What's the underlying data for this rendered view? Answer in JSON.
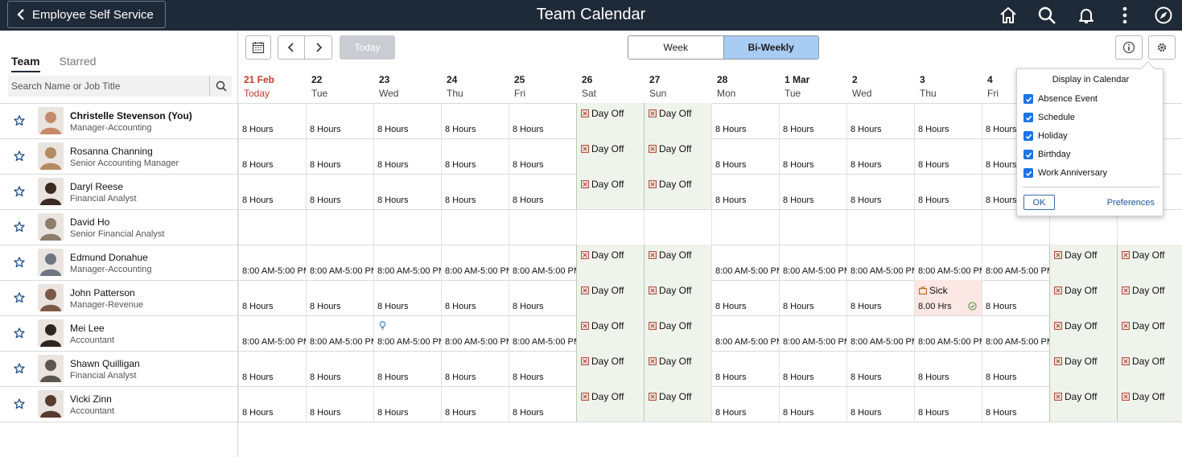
{
  "header": {
    "back_label": "Employee Self Service",
    "title": "Team Calendar",
    "icons": [
      "home-icon",
      "search-icon",
      "bell-icon",
      "more-vertical-icon",
      "compass-icon"
    ]
  },
  "left": {
    "tabs": [
      {
        "label": "Team",
        "active": true
      },
      {
        "label": "Starred",
        "active": false
      }
    ],
    "search_placeholder": "Search Name or Job Title"
  },
  "toolbar": {
    "today_label": "Today",
    "views": [
      {
        "label": "Week",
        "active": false
      },
      {
        "label": "Bi-Weekly",
        "active": true
      }
    ]
  },
  "days": [
    {
      "num": "21 Feb",
      "dow": "Today",
      "today": true
    },
    {
      "num": "22",
      "dow": "Tue"
    },
    {
      "num": "23",
      "dow": "Wed"
    },
    {
      "num": "24",
      "dow": "Thu"
    },
    {
      "num": "25",
      "dow": "Fri"
    },
    {
      "num": "26",
      "dow": "Sat"
    },
    {
      "num": "27",
      "dow": "Sun"
    },
    {
      "num": "28",
      "dow": "Mon"
    },
    {
      "num": "1 Mar",
      "dow": "Tue"
    },
    {
      "num": "2",
      "dow": "Wed"
    },
    {
      "num": "3",
      "dow": "Thu"
    },
    {
      "num": "4",
      "dow": "Fri"
    }
  ],
  "people": [
    {
      "name": "Christelle Stevenson (You)",
      "title": "Manager-Accounting",
      "me": true,
      "avatar": "#c58a6a",
      "cells": [
        {
          "t": "8 Hours"
        },
        {
          "t": "8 Hours"
        },
        {
          "t": "8 Hours"
        },
        {
          "t": "8 Hours"
        },
        {
          "t": "8 Hours"
        },
        {
          "off": "Day Off"
        },
        {
          "off": "Day Off"
        },
        {
          "t": "8 Hours"
        },
        {
          "t": "8 Hours"
        },
        {
          "t": "8 Hours"
        },
        {
          "t": "8 Hours"
        },
        {
          "t": "8 Hours"
        },
        {},
        {}
      ]
    },
    {
      "name": "Rosanna Channing",
      "title": "Senior Accounting Manager",
      "avatar": "#b38a63",
      "cells": [
        {
          "t": "8 Hours"
        },
        {
          "t": "8 Hours"
        },
        {
          "t": "8 Hours"
        },
        {
          "t": "8 Hours"
        },
        {
          "t": "8 Hours"
        },
        {
          "off": "Day Off"
        },
        {
          "off": "Day Off"
        },
        {
          "t": "8 Hours"
        },
        {
          "t": "8 Hours"
        },
        {
          "t": "8 Hours"
        },
        {
          "t": "8 Hours"
        },
        {
          "t": "8 Hours"
        },
        {},
        {}
      ]
    },
    {
      "name": "Daryl Reese",
      "title": "Financial Analyst",
      "avatar": "#3b2a22",
      "cells": [
        {
          "t": "8 Hours"
        },
        {
          "t": "8 Hours"
        },
        {
          "t": "8 Hours"
        },
        {
          "t": "8 Hours"
        },
        {
          "t": "8 Hours"
        },
        {
          "off": "Day Off"
        },
        {
          "off": "Day Off"
        },
        {
          "t": "8 Hours"
        },
        {
          "t": "8 Hours"
        },
        {
          "t": "8 Hours"
        },
        {
          "t": "8 Hours"
        },
        {
          "t": "8 Hours"
        },
        {},
        {}
      ]
    },
    {
      "name": "David Ho",
      "title": "Senior Financial Analyst",
      "avatar": "#8c7d6d",
      "cells": [
        {},
        {},
        {},
        {},
        {},
        {},
        {},
        {},
        {},
        {},
        {},
        {},
        {},
        {}
      ]
    },
    {
      "name": "Edmund Donahue",
      "title": "Manager-Accounting",
      "avatar": "#6d7582",
      "cells": [
        {
          "t": "8:00 AM-5:00 PM"
        },
        {
          "t": "8:00 AM-5:00 PM"
        },
        {
          "t": "8:00 AM-5:00 PM"
        },
        {
          "t": "8:00 AM-5:00 PM"
        },
        {
          "t": "8:00 AM-5:00 PM"
        },
        {
          "off": "Day Off"
        },
        {
          "off": "Day Off"
        },
        {
          "t": "8:00 AM-5:00 PM"
        },
        {
          "t": "8:00 AM-5:00 PM"
        },
        {
          "t": "8:00 AM-5:00 PM"
        },
        {
          "t": "8:00 AM-5:00 PM"
        },
        {
          "t": "8:00 AM-5:00 PM"
        },
        {
          "off": "Day Off"
        },
        {
          "off": "Day Off"
        }
      ]
    },
    {
      "name": "John Patterson",
      "title": "Manager-Revenue",
      "avatar": "#7a5a45",
      "cells": [
        {
          "t": "8 Hours"
        },
        {
          "t": "8 Hours"
        },
        {
          "t": "8 Hours"
        },
        {
          "t": "8 Hours"
        },
        {
          "t": "8 Hours"
        },
        {
          "off": "Day Off"
        },
        {
          "off": "Day Off"
        },
        {
          "t": "8 Hours"
        },
        {
          "t": "8 Hours"
        },
        {
          "t": "8 Hours"
        },
        {
          "sick": "Sick",
          "t": "8.00 Hrs"
        },
        {
          "t": "8 Hours"
        },
        {
          "off": "Day Off"
        },
        {
          "off": "Day Off"
        }
      ]
    },
    {
      "name": "Mei Lee",
      "title": "Accountant",
      "avatar": "#2e2420",
      "cells": [
        {
          "t": "8:00 AM-5:00 PM"
        },
        {
          "t": "8:00 AM-5:00 PM"
        },
        {
          "t": "8:00 AM-5:00 PM",
          "bulb": true
        },
        {
          "t": "8:00 AM-5:00 PM"
        },
        {
          "t": "8:00 AM-5:00 PM"
        },
        {
          "off": "Day Off"
        },
        {
          "off": "Day Off"
        },
        {
          "t": "8:00 AM-5:00 PM"
        },
        {
          "t": "8:00 AM-5:00 PM"
        },
        {
          "t": "8:00 AM-5:00 PM"
        },
        {
          "t": "8:00 AM-5:00 PM"
        },
        {
          "t": "8:00 AM-5:00 PM"
        },
        {
          "off": "Day Off"
        },
        {
          "off": "Day Off"
        }
      ]
    },
    {
      "name": "Shawn Quilligan",
      "title": "Financial Analyst",
      "avatar": "#5d5650",
      "cells": [
        {
          "t": "8 Hours"
        },
        {
          "t": "8 Hours"
        },
        {
          "t": "8 Hours"
        },
        {
          "t": "8 Hours"
        },
        {
          "t": "8 Hours"
        },
        {
          "off": "Day Off"
        },
        {
          "off": "Day Off"
        },
        {
          "t": "8 Hours"
        },
        {
          "t": "8 Hours"
        },
        {
          "t": "8 Hours"
        },
        {
          "t": "8 Hours"
        },
        {
          "t": "8 Hours"
        },
        {
          "off": "Day Off"
        },
        {
          "off": "Day Off"
        }
      ]
    },
    {
      "name": "Vicki Zinn",
      "title": "Accountant",
      "avatar": "#5a3a2e",
      "cells": [
        {
          "t": "8 Hours"
        },
        {
          "t": "8 Hours"
        },
        {
          "t": "8 Hours"
        },
        {
          "t": "8 Hours"
        },
        {
          "t": "8 Hours"
        },
        {
          "off": "Day Off"
        },
        {
          "off": "Day Off"
        },
        {
          "t": "8 Hours"
        },
        {
          "t": "8 Hours"
        },
        {
          "t": "8 Hours"
        },
        {
          "t": "8 Hours"
        },
        {
          "t": "8 Hours"
        },
        {
          "off": "Day Off"
        },
        {
          "off": "Day Off"
        }
      ]
    }
  ],
  "popup": {
    "title": "Display in Calendar",
    "options": [
      {
        "label": "Absence Event",
        "checked": true
      },
      {
        "label": "Schedule",
        "checked": true
      },
      {
        "label": "Holiday",
        "checked": true
      },
      {
        "label": "Birthday",
        "checked": true
      },
      {
        "label": "Work Anniversary",
        "checked": true
      }
    ],
    "ok_label": "OK",
    "preferences_label": "Preferences"
  },
  "colors": {
    "header_bg": "#1f2a38",
    "today_red": "#c0392b",
    "dayoff_bg": "#eef3ec",
    "sick_bg": "#fbe7e3",
    "accent": "#1a73e8",
    "active_view": "#a9ccf3"
  }
}
